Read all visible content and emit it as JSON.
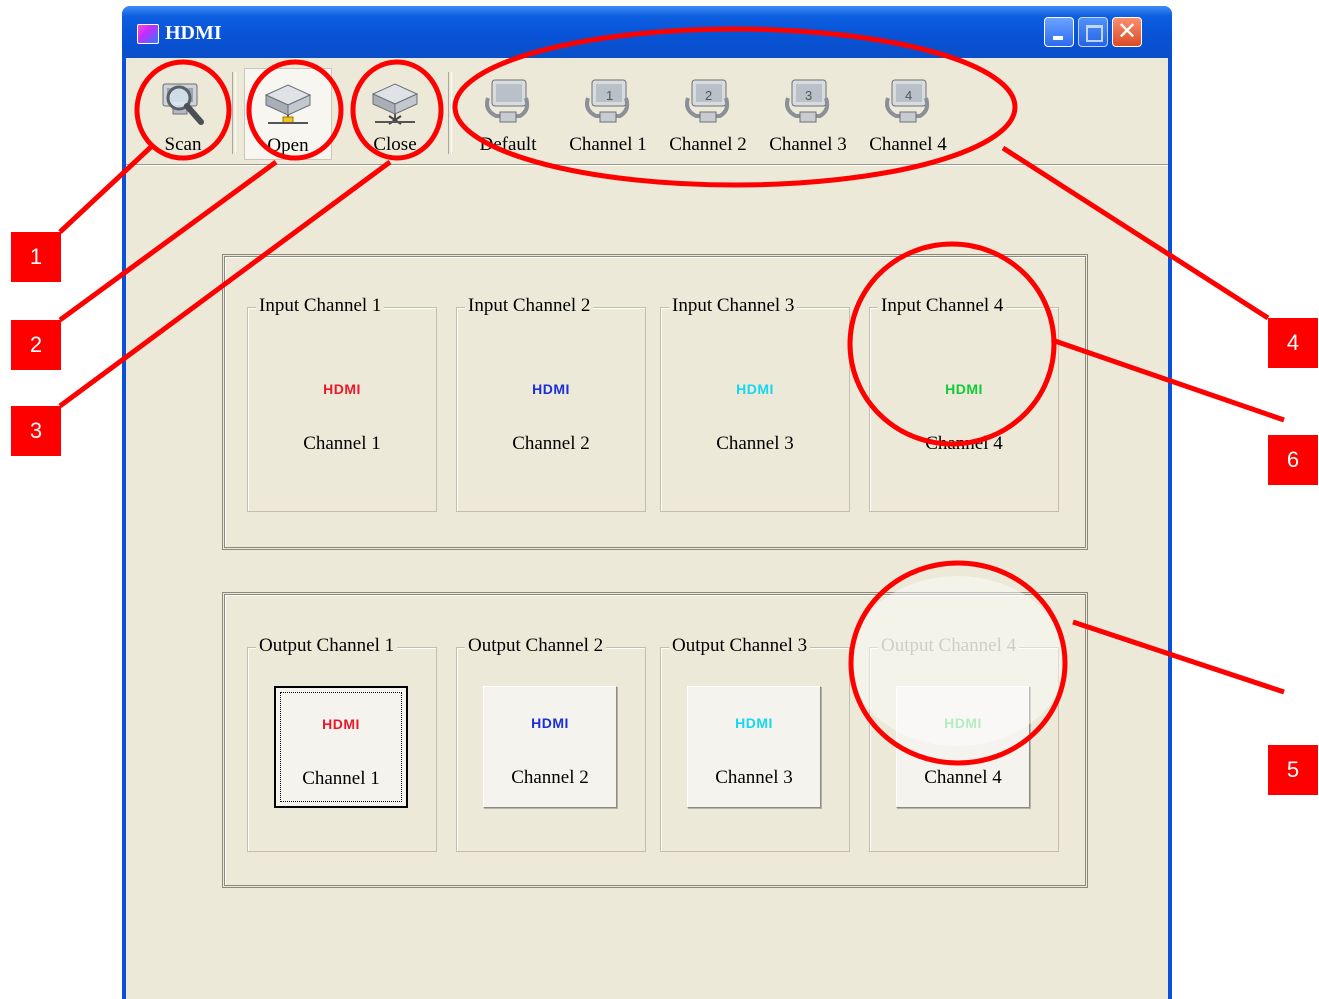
{
  "window": {
    "title": "HDMI",
    "controls": {
      "minimize_icon": "minimize-icon",
      "maximize_icon": "maximize-icon",
      "close_glyph": "✕"
    }
  },
  "toolbar": {
    "items": [
      {
        "label": "Scan",
        "icon": "scan-magnifier-icon"
      },
      {
        "label": "Open",
        "icon": "device-open-icon"
      },
      {
        "label": "Close",
        "icon": "device-close-icon"
      },
      {
        "label": "Default",
        "icon": "monitor-default-icon"
      },
      {
        "label": "Channel 1",
        "icon": "monitor-channel-1-icon"
      },
      {
        "label": "Channel 2",
        "icon": "monitor-channel-2-icon"
      },
      {
        "label": "Channel 3",
        "icon": "monitor-channel-3-icon"
      },
      {
        "label": "Channel 4",
        "icon": "monitor-channel-4-icon"
      }
    ]
  },
  "inputs": [
    {
      "legend": "Input Channel 1",
      "logo": "HDMI",
      "name": "Channel 1",
      "color": "#e8192a"
    },
    {
      "legend": "Input Channel 2",
      "logo": "HDMI",
      "name": "Channel 2",
      "color": "#1a2fd8"
    },
    {
      "legend": "Input Channel 3",
      "logo": "HDMI",
      "name": "Channel 3",
      "color": "#17d6f0"
    },
    {
      "legend": "Input Channel 4",
      "logo": "HDMI",
      "name": "Channel 4",
      "color": "#12c93b"
    }
  ],
  "outputs": [
    {
      "legend": "Output Channel 1",
      "logo": "HDMI",
      "name": "Channel 1",
      "color": "#e8192a"
    },
    {
      "legend": "Output Channel 2",
      "logo": "HDMI",
      "name": "Channel 2",
      "color": "#1a2fd8"
    },
    {
      "legend": "Output Channel 3",
      "logo": "HDMI",
      "name": "Channel 3",
      "color": "#17d6f0"
    },
    {
      "legend": "Output Channel 4",
      "logo": "HDMI",
      "name": "Channel 4",
      "color": "#12c93b"
    }
  ],
  "annotations": {
    "highlight_color": "#ff0000",
    "badges": [
      "1",
      "2",
      "3",
      "4",
      "5",
      "6"
    ]
  }
}
